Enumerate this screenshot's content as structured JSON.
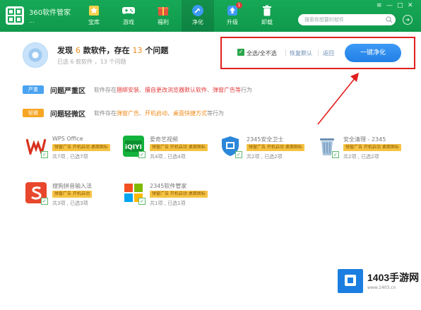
{
  "header": {
    "app_title": "360软件管家",
    "app_sub": "...",
    "nav": [
      {
        "label": "宝库",
        "icon": "star-icon"
      },
      {
        "label": "游戏",
        "icon": "gamepad-icon"
      },
      {
        "label": "福利",
        "icon": "gift-icon"
      },
      {
        "label": "净化",
        "icon": "broom-icon",
        "active": true
      },
      {
        "label": "升级",
        "icon": "upgrade-icon",
        "badge": "1"
      },
      {
        "label": "卸载",
        "icon": "trash-icon"
      }
    ],
    "search_placeholder": "搜索你想要的软件",
    "window_controls": [
      "≡",
      "—",
      "□",
      "✕"
    ]
  },
  "summary": {
    "title_prefix": "发现",
    "app_count": "6",
    "title_mid": "款软件，存在",
    "issue_count": "13",
    "title_suffix": "个问题",
    "subtitle": "已选 6 款软件 ，13 个问题"
  },
  "actions": {
    "select_all": "全选/全不选",
    "restore_default": "恢复默认",
    "back": "返回",
    "purify_button": "一键净化"
  },
  "sections": {
    "serious": {
      "tag": "严重",
      "title": "问题严重区",
      "desc_prefix": "软件存在",
      "desc_red1": "捆绑安装",
      "desc_red2": "擅自更改浏览器默认软件",
      "desc_red3": "弹窗广告等",
      "desc_suffix": "行为"
    },
    "minor": {
      "tag": "轻微",
      "title": "问题轻微区",
      "desc_prefix": "软件存在",
      "desc_org1": "弹窗广告",
      "desc_org2": "开机启动",
      "desc_org3": "桌面快捷方式",
      "desc_suffix": "等行为"
    }
  },
  "apps": [
    {
      "name": "WPS Office",
      "tag": "弹窗广告 开机启动 桌面图标",
      "meta": "共7项 , 已选7项",
      "icon": "wps-icon",
      "color": "#d8321e",
      "glyph": "W"
    },
    {
      "name": "爱奇艺视频",
      "tag": "弹窗广告 开机启动 桌面图标",
      "meta": "共4项 , 已选4项",
      "icon": "iqiyi-icon",
      "color": "#12b33c",
      "glyph": "i"
    },
    {
      "name": "2345安全卫士",
      "tag": "弹窗广告 开机启动 桌面图标",
      "meta": "共2项 , 已选2项",
      "icon": "shield-icon",
      "color": "#2b87d8",
      "glyph": "⛨"
    },
    {
      "name": "安全清理 - 2345",
      "tag": "弹窗广告 开机启动 桌面图标",
      "meta": "共2项 , 已选2项",
      "icon": "recycle-bin-icon",
      "color": "#7fa8c9",
      "glyph": "🗑"
    },
    {
      "name": "搜狗拼音输入法",
      "tag": "弹窗广告 开机启动",
      "meta": "共3项 , 已选3项",
      "icon": "sogou-icon",
      "color": "#e8472d",
      "glyph": "S"
    },
    {
      "name": "2345软件管家",
      "tag": "弹窗广告 开机启动 桌面图标",
      "meta": "共1项 , 已选1项",
      "icon": "windows-logo-icon",
      "color": "#ffffff",
      "glyph": ""
    }
  ],
  "watermark": {
    "brand": "1403手游网",
    "url": "www.1403.cn"
  },
  "colors": {
    "header_green": "#17a857",
    "primary_blue": "#2380e6",
    "highlight_red": "#e11e1e",
    "tag_serious": "#4aa3f0",
    "tag_minor": "#f6a623"
  }
}
